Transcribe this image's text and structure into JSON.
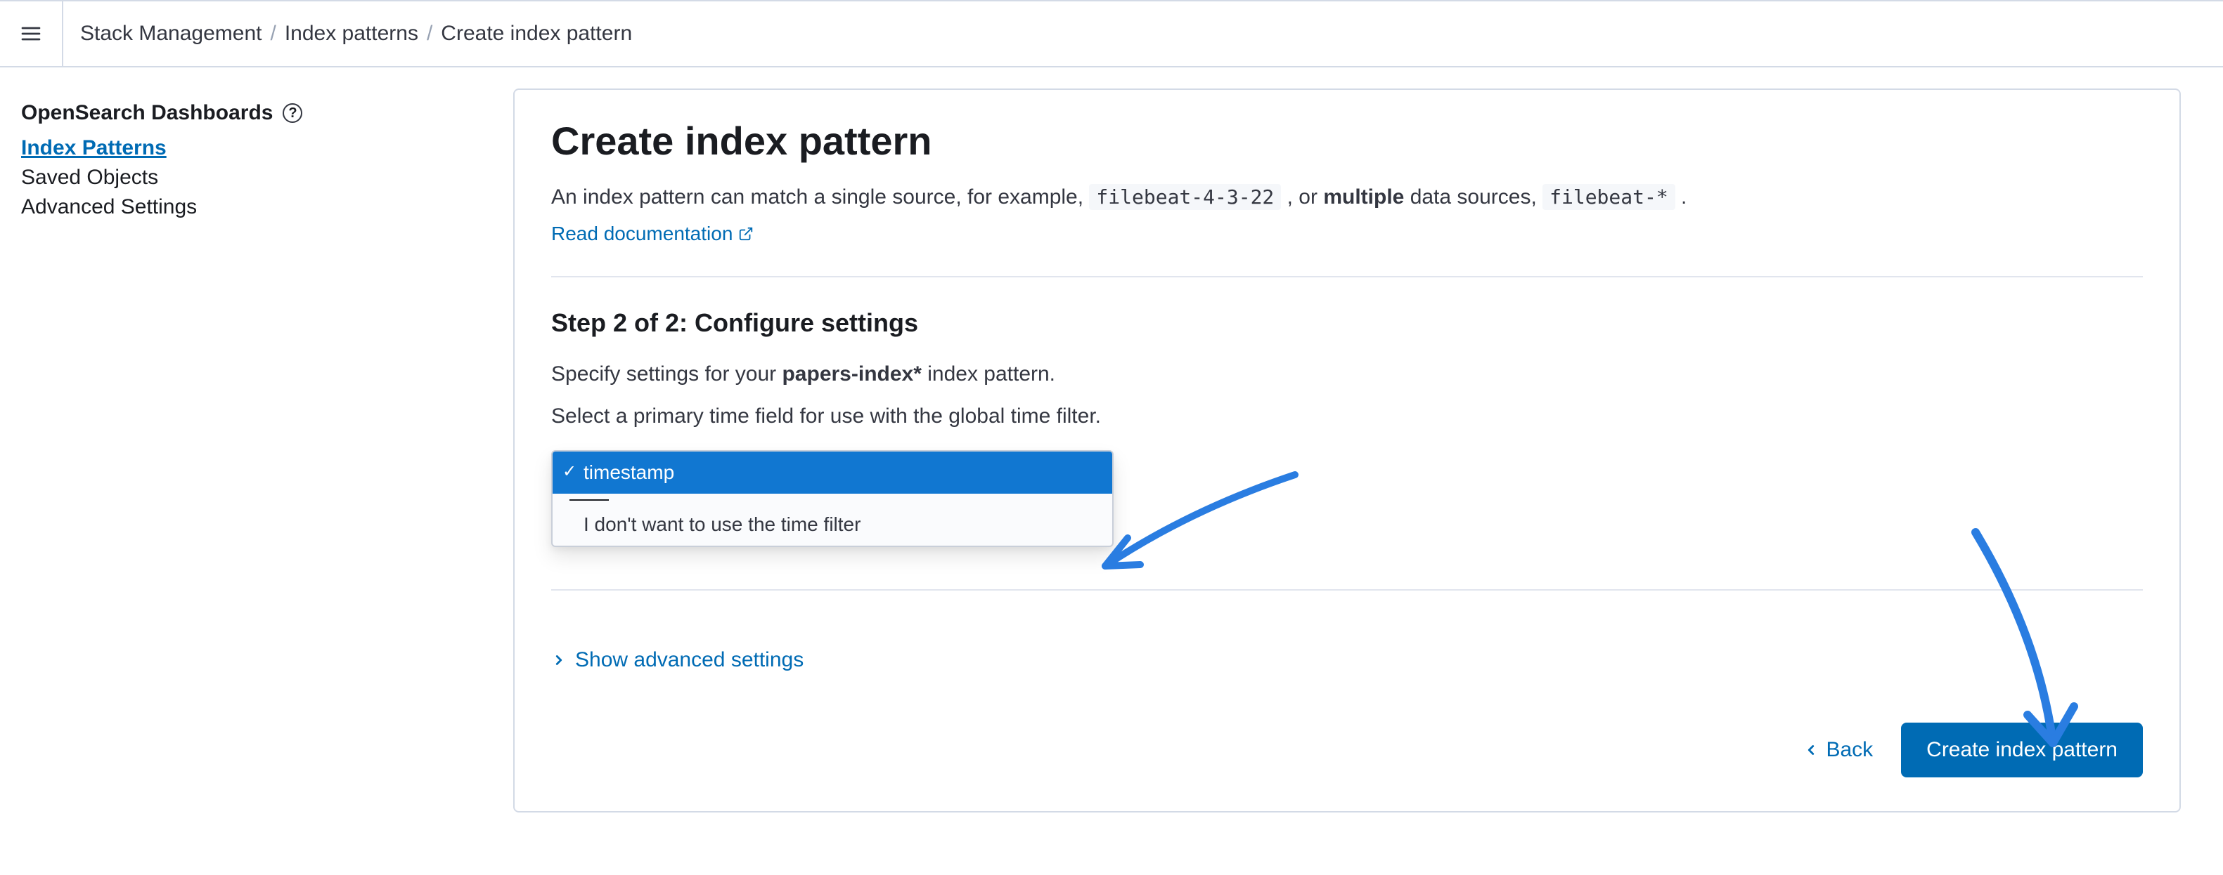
{
  "breadcrumb": {
    "items": [
      "Stack Management",
      "Index patterns"
    ],
    "current": "Create index pattern"
  },
  "sidebar": {
    "title": "OpenSearch Dashboards",
    "items": [
      {
        "label": "Index Patterns",
        "active": true
      },
      {
        "label": "Saved Objects",
        "active": false
      },
      {
        "label": "Advanced Settings",
        "active": false
      }
    ]
  },
  "main": {
    "title": "Create index pattern",
    "desc_prefix": "An index pattern can match a single source, for example, ",
    "code1": "filebeat-4-3-22",
    "desc_mid": " , or ",
    "desc_bold": "multiple",
    "desc_after_bold": " data sources, ",
    "code2": "filebeat-*",
    "desc_end": " .",
    "read_doc": "Read documentation",
    "step_title": "Step 2 of 2: Configure settings",
    "settings_prefix": "Specify settings for your ",
    "pattern_name": "papers-index*",
    "settings_suffix": " index pattern.",
    "time_hint": "Select a primary time field for use with the global time filter.",
    "dropdown": {
      "selected": "timestamp",
      "alt": "I don't want to use the time filter"
    },
    "adv": "Show advanced settings",
    "back": "Back",
    "create": "Create index pattern"
  }
}
